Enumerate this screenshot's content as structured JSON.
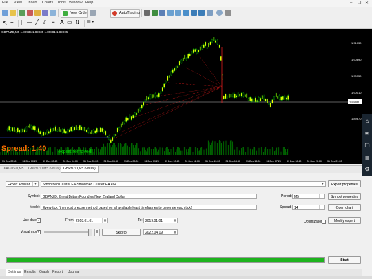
{
  "menu": {
    "items": [
      "File",
      "View",
      "Insert",
      "Charts",
      "Tools",
      "Window",
      "Help"
    ]
  },
  "toolbar": {
    "new_order_label": "New Order",
    "autotrading_label": "AutoTrading"
  },
  "chart": {
    "title": "GBPNZD,M5  1.89935 1.89935 1.89881 1.89905",
    "spread_label": "Spread: 1.40",
    "expert_removed": "expert removed",
    "price_labels": [
      "1.91030",
      "1.90690",
      "1.90350",
      "1.90010",
      "1.89881",
      "1.89670"
    ],
    "current_price": "1.89881",
    "time_labels": [
      "31 Dec 2018",
      "31 Dec 00:20",
      "31 Dec 02:40",
      "31 Dec 04:00",
      "31 Dec 05:20",
      "31 Dec 06:40",
      "31 Dec 08:00",
      "31 Dec 09:20",
      "31 Dec 10:40",
      "31 Dec 12:00",
      "31 Dec 13:20",
      "31 Dec 14:40",
      "31 Dec 16:00",
      "31 Dec 17:20",
      "31 Dec 18:40",
      "31 Dec 20:00",
      "31 Dec 21:20"
    ],
    "colors": {
      "up": "#ffff00",
      "down": "#00c000",
      "volume": "#00c800",
      "arrow": "#ff2020",
      "spread": "#ff6a00"
    }
  },
  "chart_tabs": [
    "XAGUSD,M5",
    "GBPNZD,M5 (visual)",
    "GBPNZD,M5 (visual)"
  ],
  "tester": {
    "expert_advisor_mode": "Expert Advisor",
    "expert_file": "Smoothed Cluster EA\\Smoothed Cluster EA.ex4",
    "symbol_label": "Symbol:",
    "symbol_value": "GBPNZD, Great Britain Pound vs New Zealand Dollar",
    "model_label": "Model:",
    "model_value": "Every tick (the most precise method based on all available least timeframes to generate each tick)",
    "use_date_label": "Use date",
    "use_date_checked": true,
    "from_label": "From:",
    "from_value": "2018.01.01",
    "to_label": "To:",
    "to_value": "2019.01.01",
    "visual_mode_label": "Visual mode",
    "visual_mode_checked": true,
    "skip_to_label": "Skip to",
    "skip_to_value": "2022.04.19",
    "period_label": "Period:",
    "period_value": "M5",
    "spread_label": "Spread:",
    "spread_value": "14",
    "optimization_label": "Optimization",
    "optimization_checked": false,
    "buttons": {
      "expert_properties": "Expert properties",
      "symbol_properties": "Symbol properties",
      "open_chart": "Open chart",
      "modify_expert": "Modify expert",
      "start": "Start"
    },
    "progress_fraction": 1.0,
    "progress_color": "#1db31d"
  },
  "bottom_tabs": [
    "Settings",
    "Results",
    "Graph",
    "Report",
    "Journal"
  ]
}
